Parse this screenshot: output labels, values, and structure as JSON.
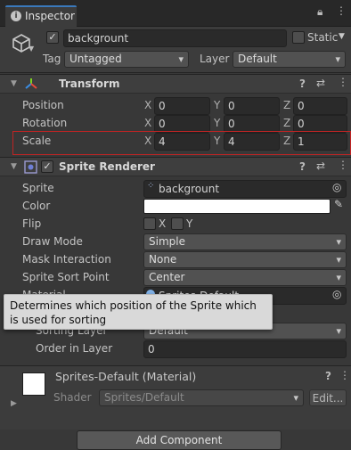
{
  "tab": {
    "label": "Inspector"
  },
  "gameobject": {
    "name": "backgrount",
    "static_label": "Static",
    "tag_label": "Tag",
    "tag_value": "Untagged",
    "layer_label": "Layer",
    "layer_value": "Default"
  },
  "transform": {
    "title": "Transform",
    "position": {
      "label": "Position",
      "x": "0",
      "y": "0",
      "z": "0"
    },
    "rotation": {
      "label": "Rotation",
      "x": "0",
      "y": "0",
      "z": "0"
    },
    "scale": {
      "label": "Scale",
      "x": "4",
      "y": "4",
      "z": "1"
    },
    "axis_x": "X",
    "axis_y": "Y",
    "axis_z": "Z"
  },
  "sprite_renderer": {
    "title": "Sprite Renderer",
    "sprite_label": "Sprite",
    "sprite_value": "backgrount",
    "color_label": "Color",
    "color_value": "#FFFFFF",
    "flip_label": "Flip",
    "flip_x": "X",
    "flip_y": "Y",
    "draw_mode_label": "Draw Mode",
    "draw_mode_value": "Simple",
    "mask_label": "Mask Interaction",
    "mask_value": "None",
    "sort_point_label": "Sprite Sort Point",
    "sort_point_value": "Center",
    "material_label": "Material",
    "material_value": "Sprites-Default",
    "sorting_layer_label": "Sorting Layer",
    "sorting_layer_value": "Default",
    "order_label": "Order in Layer",
    "order_value": "0"
  },
  "tooltip": {
    "text": "Determines which position of the Sprite which is used for sorting"
  },
  "material": {
    "title": "Sprites-Default (Material)",
    "shader_label": "Shader",
    "shader_value": "Sprites/Default",
    "edit_label": "Edit..."
  },
  "add_component": {
    "label": "Add Component"
  }
}
